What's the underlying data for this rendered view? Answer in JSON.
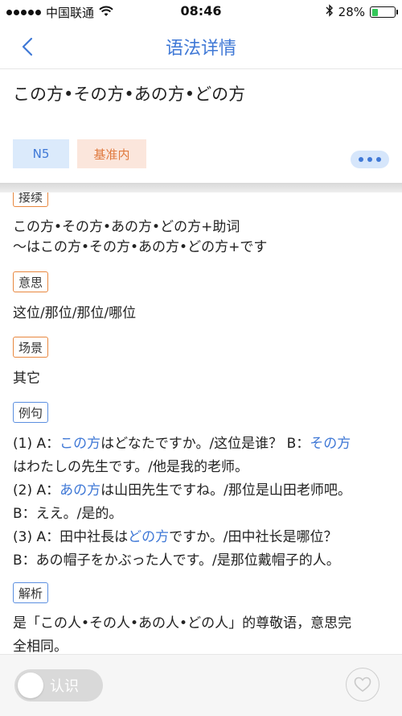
{
  "status_bar": {
    "carrier": "中国联通",
    "time": "08:46",
    "battery_percent": "28%",
    "battery_level": 0.28,
    "battery_color": "#34c759"
  },
  "nav": {
    "title": "语法详情",
    "back_icon": "chevron-left-icon"
  },
  "grammar": {
    "title": "この方•その方•あの方•どの方",
    "tags": [
      "N5",
      "基准内"
    ]
  },
  "sections": {
    "connect": {
      "label": "接续",
      "lines": [
        "この方•その方•あの方•どの方+助词",
        "～はこの方•その方•あの方•どの方+です"
      ]
    },
    "meaning": {
      "label": "意思",
      "text": "这位/那位/那位/哪位"
    },
    "scene": {
      "label": "场景",
      "text": "其它"
    },
    "examples": {
      "label": "例句",
      "lines": [
        [
          "(1) A：",
          "この方",
          "はどなたですか。/这位是谁？ B：",
          "その方"
        ],
        [
          "はわたしの先生です。/他是我的老师。"
        ],
        [
          "(2) A：",
          "あの方",
          "は山田先生ですね。/那位是山田老师吧。"
        ],
        [
          "B：ええ。/是的。"
        ],
        [
          "(3) A：田中社長は",
          "どの方",
          "ですか。/田中社长是哪位？"
        ],
        [
          "B：あの帽子をかぶった人です。/是那位戴帽子的人。"
        ]
      ]
    },
    "analysis": {
      "label": "解析",
      "lines": [
        "是「この人•その人•あの人•どの人」的尊敬语，意思完",
        "全相同。"
      ]
    }
  },
  "bottom": {
    "toggle_label": "认识",
    "fav_icon": "heart-icon"
  },
  "colors": {
    "accent_blue": "#3f78d6",
    "orange": "#e8873f"
  }
}
